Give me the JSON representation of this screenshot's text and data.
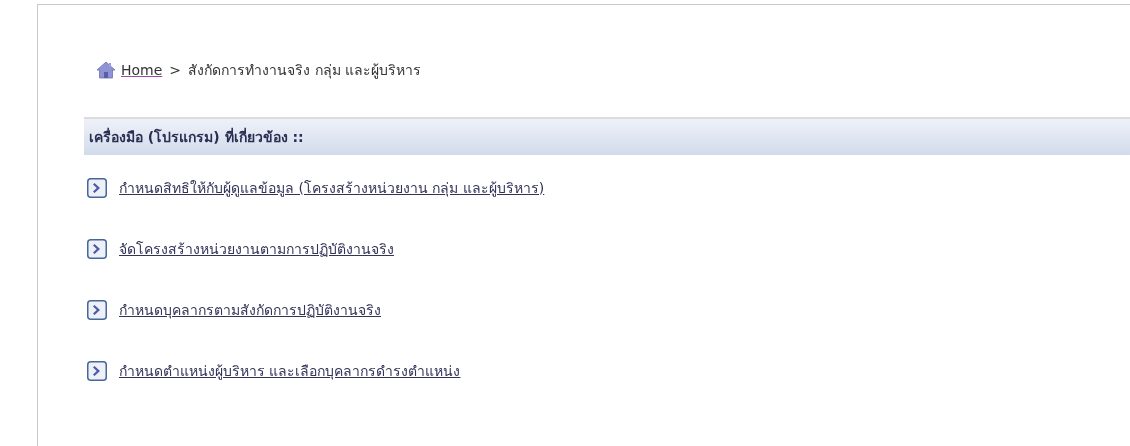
{
  "breadcrumb": {
    "home": "Home",
    "separator": ">",
    "current": "สังกัดการทำงานจริง กลุ่ม และผู้บริหาร"
  },
  "section": {
    "title": "เครื่องมือ (โปรแกรม) ที่เกี่ยวข้อง ::",
    "links": [
      {
        "label": "กำหนดสิทธิให้กับผู้ดูแลข้อมูล (โครงสร้างหน่วยงาน กลุ่ม และผู้บริหาร)"
      },
      {
        "label": "จัดโครงสร้างหน่วยงานตามการปฏิบัติงานจริง"
      },
      {
        "label": "กำหนดบุคลากรตามสังกัดการปฏิบัติงานจริง"
      },
      {
        "label": "กำหนดตำแหน่งผู้บริหาร และเลือกบุคลากรดำรงตำแหน่ง"
      }
    ]
  }
}
